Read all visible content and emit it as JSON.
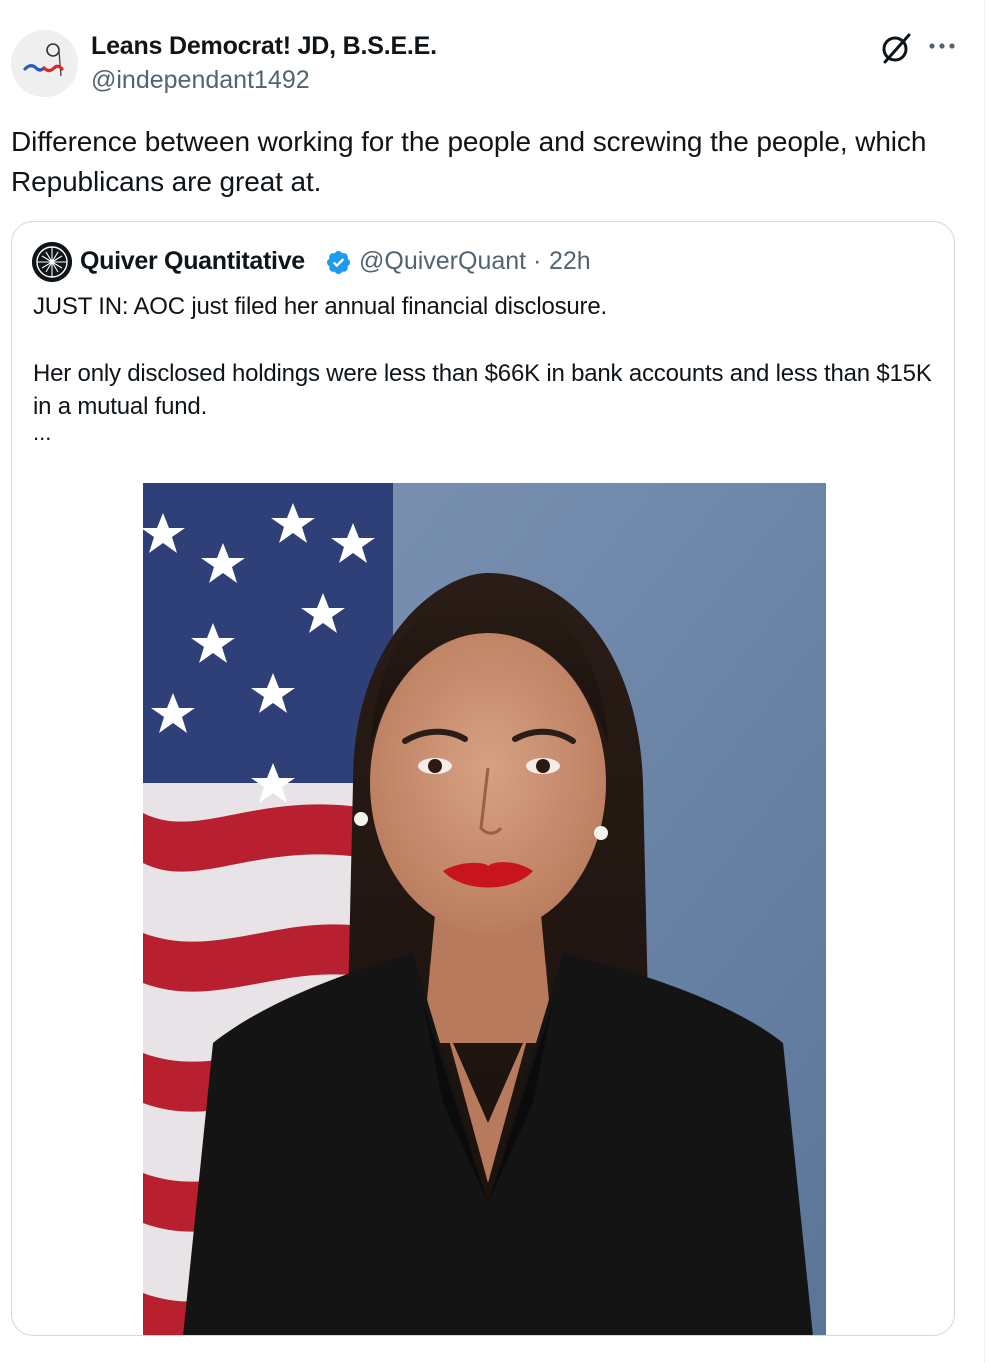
{
  "post": {
    "author_name": "Leans Democrat! JD, B.S.E.E.",
    "author_handle": "@independant1492",
    "text": "Difference between working for the people and screwing the people, which Republicans are great at."
  },
  "quoted_post": {
    "author_name": "Quiver Quantitative",
    "author_handle": "@QuiverQuant",
    "separator": "·",
    "time": "22h",
    "line1": "JUST IN: AOC just filed her annual financial disclosure.",
    "line2": "Her only disclosed holdings were less than $66K in bank accounts and less than $15K in a mutual fund.",
    "ellipsis": "...",
    "verified_color": "#1d9bf0"
  },
  "icons": {
    "grok": "grok-slash-circle-icon",
    "more": "more-dots-icon",
    "verified": "verified-badge-icon"
  },
  "colors": {
    "text_primary": "#0f1419",
    "text_secondary": "#536471",
    "card_border": "#cfd9de"
  }
}
